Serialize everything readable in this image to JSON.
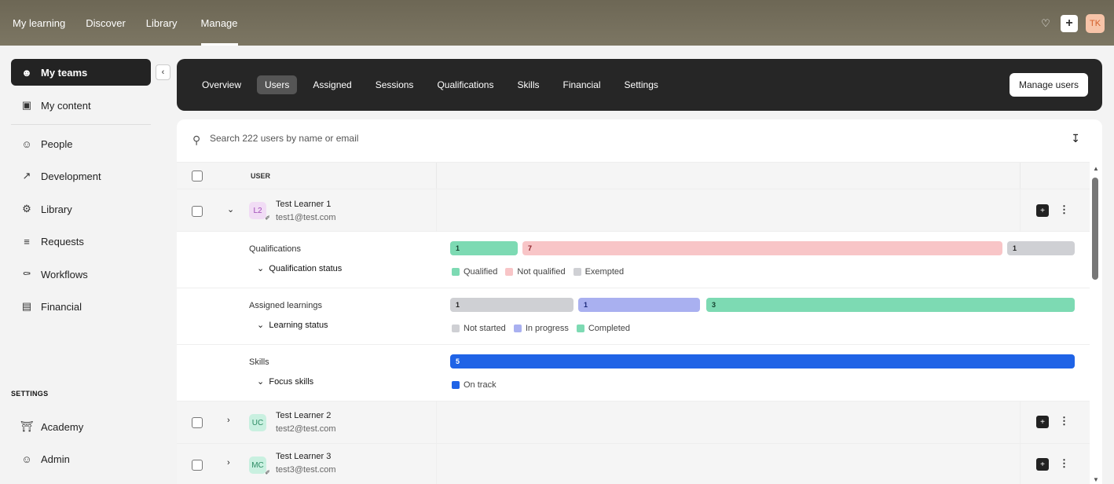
{
  "topnav": {
    "items": [
      {
        "label": "My learning"
      },
      {
        "label": "Discover"
      },
      {
        "label": "Library"
      },
      {
        "label": "Manage"
      }
    ],
    "avatar": "TK"
  },
  "sidebar": {
    "items": [
      {
        "label": "My teams",
        "icon": "teams-icon"
      },
      {
        "label": "My content",
        "icon": "content-icon"
      },
      {
        "label": "People",
        "icon": "person-icon"
      },
      {
        "label": "Development",
        "icon": "trend-icon"
      },
      {
        "label": "Library",
        "icon": "library-icon"
      },
      {
        "label": "Requests",
        "icon": "checklist-icon"
      },
      {
        "label": "Workflows",
        "icon": "workflow-icon"
      },
      {
        "label": "Financial",
        "icon": "money-icon"
      }
    ],
    "settings_heading": "SETTINGS",
    "settings_items": [
      {
        "label": "Academy",
        "icon": "academy-icon"
      },
      {
        "label": "Admin",
        "icon": "admin-icon"
      }
    ]
  },
  "subnav": {
    "tabs": [
      {
        "label": "Overview"
      },
      {
        "label": "Users"
      },
      {
        "label": "Assigned"
      },
      {
        "label": "Sessions"
      },
      {
        "label": "Qualifications"
      },
      {
        "label": "Skills"
      },
      {
        "label": "Financial"
      },
      {
        "label": "Settings"
      }
    ],
    "manage_users_label": "Manage users"
  },
  "search": {
    "placeholder": "Search 222 users by name or email"
  },
  "table": {
    "header_user": "USER",
    "users": [
      {
        "initials": "L2",
        "name": "Test Learner 1",
        "email": "test1@test.com",
        "avatar_bg": "#f1dcf5",
        "avatar_fg": "#a04bb8"
      },
      {
        "initials": "UC",
        "name": "Test Learner 2",
        "email": "test2@test.com",
        "avatar_bg": "#c9f0e0",
        "avatar_fg": "#2c8a63"
      },
      {
        "initials": "MC",
        "name": "Test Learner 3",
        "email": "test3@test.com",
        "avatar_bg": "#c9f0e0",
        "avatar_fg": "#2c8a63"
      }
    ],
    "details": {
      "qualifications": {
        "label": "Qualifications",
        "sub": "Qualification status",
        "values": {
          "qualified": "1",
          "not_qualified": "7",
          "exempted": "1"
        },
        "legend": [
          "Qualified",
          "Not qualified",
          "Exempted"
        ]
      },
      "learnings": {
        "label": "Assigned learnings",
        "sub": "Learning status",
        "values": {
          "not_started": "1",
          "in_progress": "1",
          "completed": "3"
        },
        "legend": [
          "Not started",
          "In progress",
          "Completed"
        ]
      },
      "skills": {
        "label": "Skills",
        "sub": "Focus skills",
        "values": {
          "on_track": "5"
        },
        "legend": [
          "On track"
        ]
      }
    }
  },
  "colors": {
    "green": "#7ddab3",
    "pink": "#f8c5c7",
    "grey": "#cfd0d4",
    "purple": "#a9b0f0",
    "blue": "#1f63e6"
  }
}
